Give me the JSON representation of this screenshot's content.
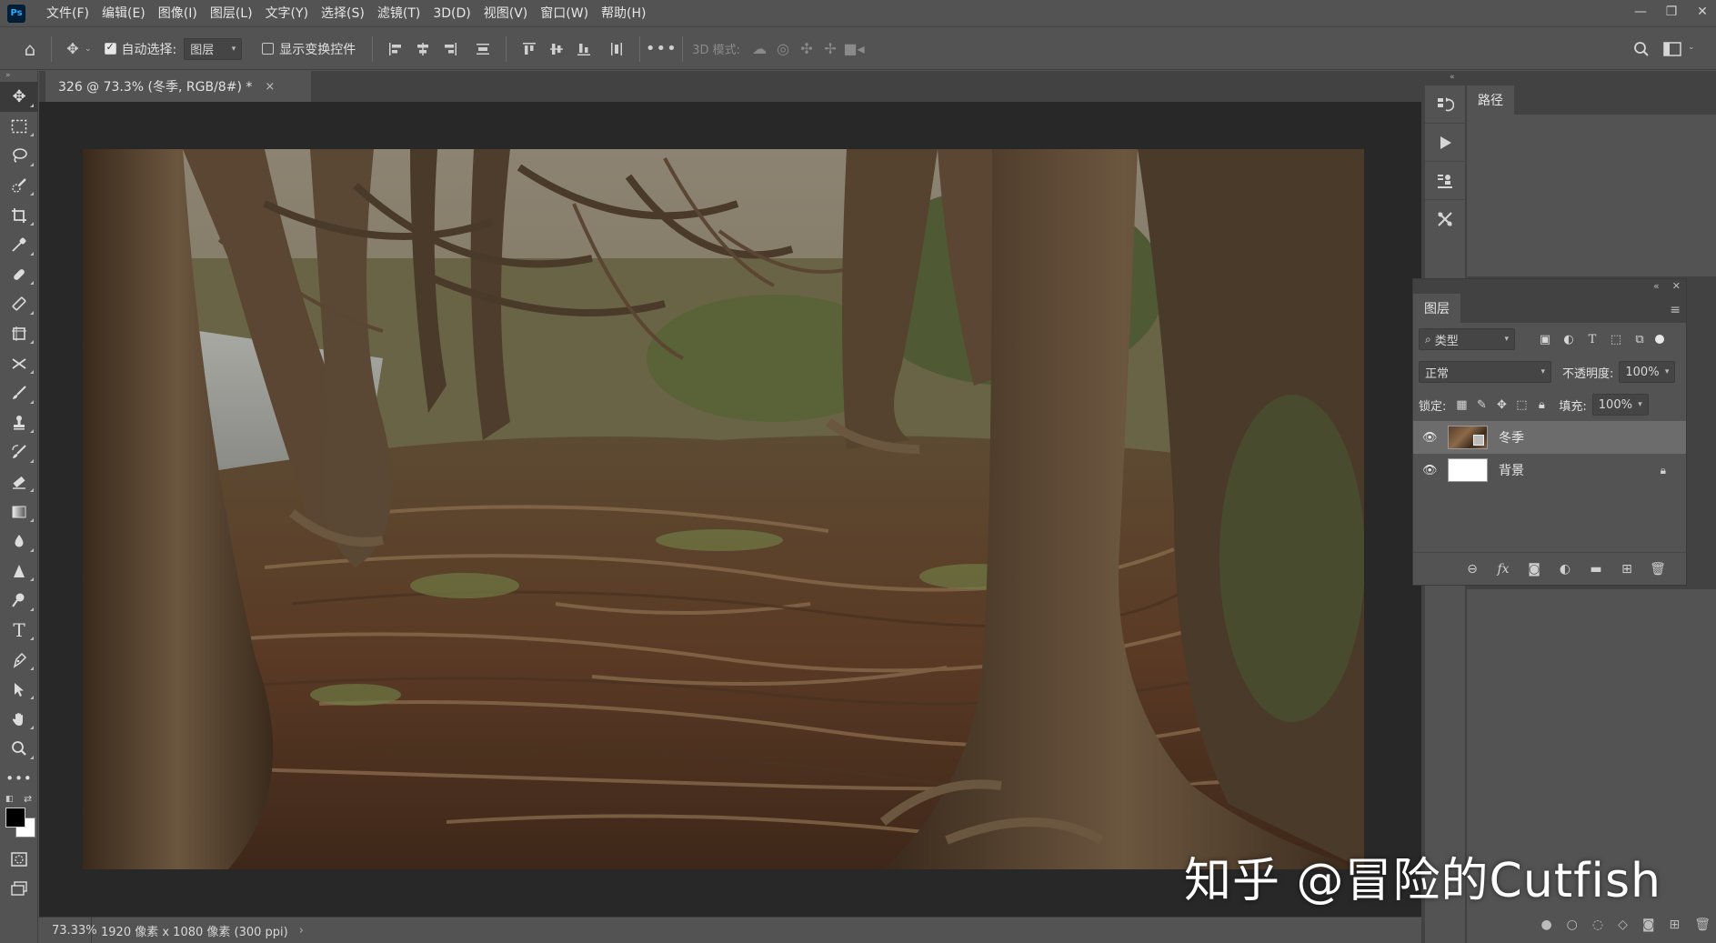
{
  "menubar": {
    "logo": "Ps",
    "items": [
      "文件(F)",
      "编辑(E)",
      "图像(I)",
      "图层(L)",
      "文字(Y)",
      "选择(S)",
      "滤镜(T)",
      "3D(D)",
      "视图(V)",
      "窗口(W)",
      "帮助(H)"
    ]
  },
  "options": {
    "auto_select_label": "自动选择:",
    "auto_select_target": "图层",
    "show_transform_label": "显示变换控件",
    "mode_3d_label": "3D 模式:"
  },
  "document": {
    "tab_title": "326 @ 73.3% (冬季, RGB/8#) *",
    "close_glyph": "×"
  },
  "status": {
    "zoom": "73.33%",
    "info": "1920 像素 x 1080 像素 (300 ppi)",
    "more_glyph": "›"
  },
  "paths_panel": {
    "tab": "路径"
  },
  "layers_panel": {
    "tab": "图层",
    "filter_kind": "类型",
    "blend_mode": "正常",
    "opacity_label": "不透明度:",
    "opacity_value": "100%",
    "lock_label": "锁定:",
    "fill_label": "填充:",
    "fill_value": "100%",
    "layers": [
      {
        "name": "冬季",
        "selected": true
      },
      {
        "name": "背景",
        "selected": false,
        "locked": true
      }
    ]
  },
  "watermark": "知乎 @冒险的Cutfish",
  "colors": {
    "ui_bg": "#535353",
    "canvas_bg": "#282828",
    "foreground": "#000000",
    "background": "#ffffff"
  }
}
